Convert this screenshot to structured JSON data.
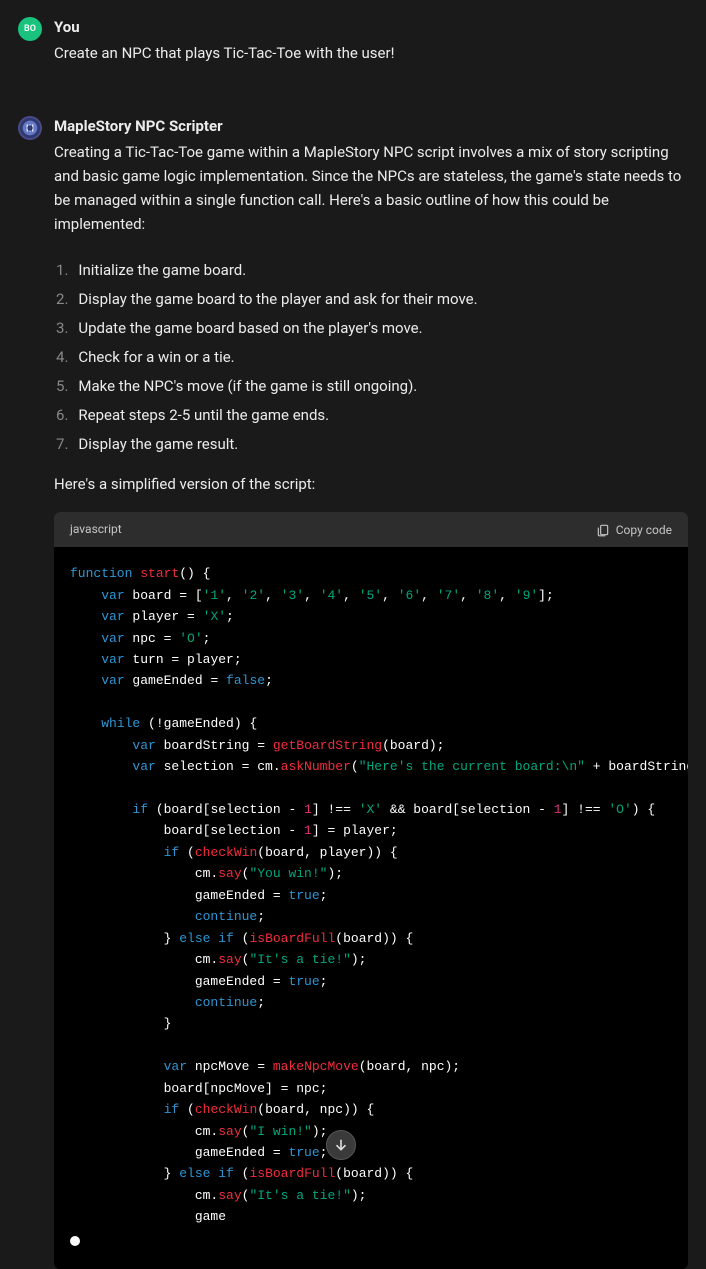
{
  "user": {
    "name": "You",
    "avatar_text": "BO",
    "message": "Create an NPC that plays Tic-Tac-Toe with the user!"
  },
  "bot": {
    "name": "MapleStory NPC Scripter",
    "intro": "Creating a Tic-Tac-Toe game within a MapleStory NPC script involves a mix of story scripting and basic game logic implementation. Since the NPCs are stateless, the game's state needs to be managed within a single function call. Here's a basic outline of how this could be implemented:",
    "steps": [
      "Initialize the game board.",
      "Display the game board to the player and ask for their move.",
      "Update the game board based on the player's move.",
      "Check for a win or a tie.",
      "Make the NPC's move (if the game is still ongoing).",
      "Repeat steps 2-5 until the game ends.",
      "Display the game result."
    ],
    "pre_code": "Here's a simplified version of the script:",
    "code_lang": "javascript",
    "copy_label": "Copy code"
  },
  "chart_data": null
}
